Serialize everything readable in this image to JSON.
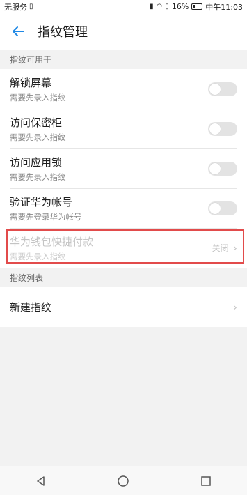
{
  "status": {
    "carrier": "无服务",
    "battery": "16%",
    "time": "中午11:03"
  },
  "header": {
    "title": "指纹管理"
  },
  "section_usage": {
    "title": "指纹可用于",
    "items": [
      {
        "title": "解锁屏幕",
        "subtitle": "需要先录入指纹"
      },
      {
        "title": "访问保密柜",
        "subtitle": "需要先录入指纹"
      },
      {
        "title": "访问应用锁",
        "subtitle": "需要先录入指纹"
      },
      {
        "title": "验证华为帐号",
        "subtitle": "需要先登录华为帐号"
      }
    ],
    "wallet": {
      "title": "华为钱包快捷付款",
      "subtitle": "需要先录入指纹",
      "value": "关闭"
    }
  },
  "section_list": {
    "title": "指纹列表",
    "new_label": "新建指纹"
  },
  "colors": {
    "accent": "#1e88e5",
    "highlight": "#e24b4b"
  }
}
